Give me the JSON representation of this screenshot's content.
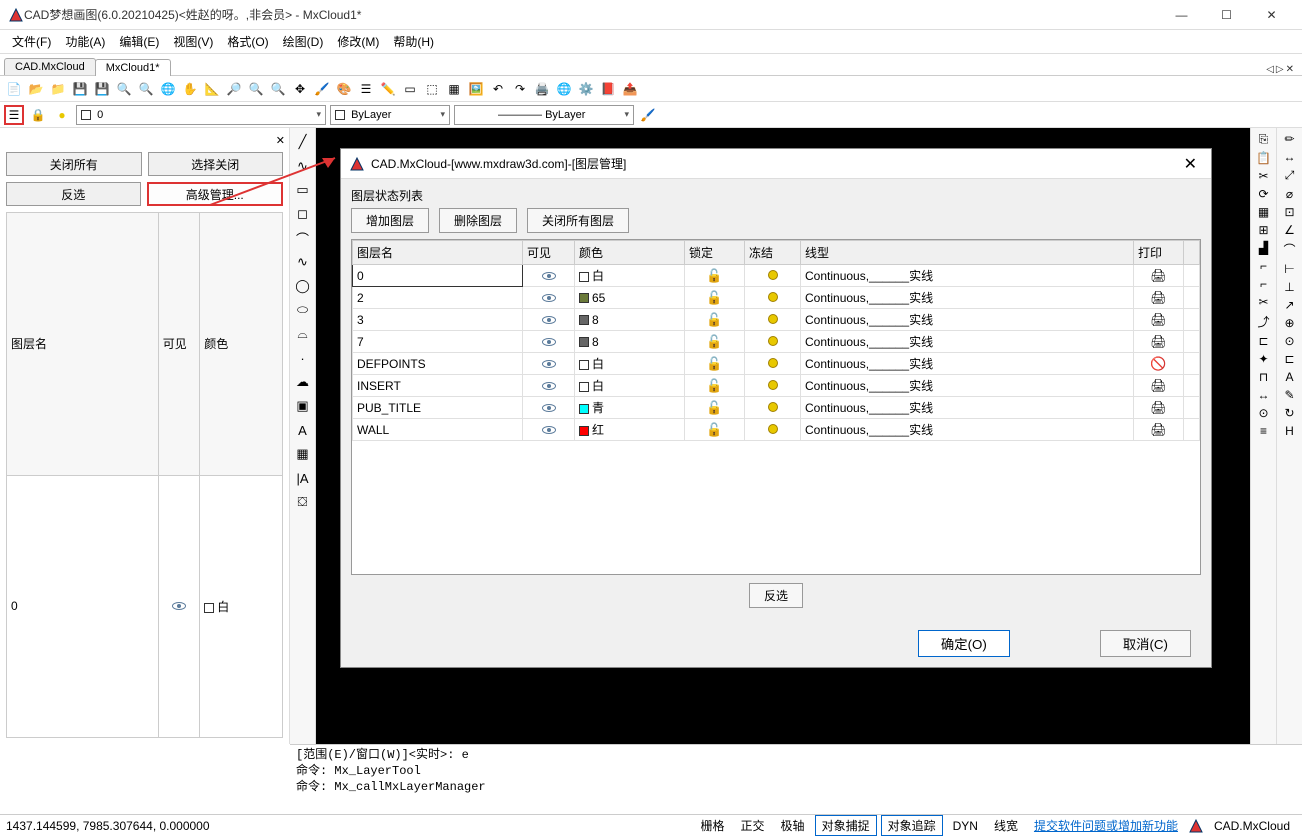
{
  "window": {
    "title": "CAD梦想画图(6.0.20210425)<姓赵的呀。,非会员> - MxCloud1*"
  },
  "menu": [
    "文件(F)",
    "功能(A)",
    "编辑(E)",
    "视图(V)",
    "格式(O)",
    "绘图(D)",
    "修改(M)",
    "帮助(H)"
  ],
  "tabs": {
    "t1": "CAD.MxCloud",
    "t2": "MxCloud1*"
  },
  "layercombo": {
    "value": "0"
  },
  "colorcombo": {
    "value": "ByLayer"
  },
  "ltcombo": {
    "value": "ByLayer"
  },
  "leftpanel": {
    "btn_closeall": "关闭所有",
    "btn_selclose": "选择关闭",
    "btn_invert": "反选",
    "btn_adv": "高级管理...",
    "th_name": "图层名",
    "th_vis": "可见",
    "th_color": "颜色",
    "row_name": "0",
    "row_color": "白"
  },
  "dialog": {
    "title": "CAD.MxCloud-[www.mxdraw3d.com]-[图层管理]",
    "label": "图层状态列表",
    "btn_add": "增加图层",
    "btn_del": "删除图层",
    "btn_closeall": "关闭所有图层",
    "th": {
      "name": "图层名",
      "vis": "可见",
      "color": "颜色",
      "lock": "锁定",
      "freeze": "冻结",
      "lt": "线型",
      "print": "打印"
    },
    "rows": [
      {
        "name": "0",
        "color": "白",
        "sw": "#ffffff",
        "lt": "Continuous,______实线",
        "print": "normal"
      },
      {
        "name": "2",
        "color": "65",
        "sw": "#6b7a3a",
        "lt": "Continuous,______实线",
        "print": "normal"
      },
      {
        "name": "3",
        "color": "8",
        "sw": "#666666",
        "lt": "Continuous,______实线",
        "print": "normal"
      },
      {
        "name": "7",
        "color": "8",
        "sw": "#666666",
        "lt": "Continuous,______实线",
        "print": "normal"
      },
      {
        "name": "DEFPOINTS",
        "color": "白",
        "sw": "#ffffff",
        "lt": "Continuous,______实线",
        "print": "no"
      },
      {
        "name": "INSERT",
        "color": "白",
        "sw": "#ffffff",
        "lt": "Continuous,______实线",
        "print": "normal"
      },
      {
        "name": "PUB_TITLE",
        "color": "青",
        "sw": "#00ffff",
        "lt": "Continuous,______实线",
        "print": "normal"
      },
      {
        "name": "WALL",
        "color": "红",
        "sw": "#ff0000",
        "lt": "Continuous,______实线",
        "print": "normal"
      }
    ],
    "btn_invert": "反选",
    "btn_ok": "确定(O)",
    "btn_cancel": "取消(C)"
  },
  "cmd": {
    "l1": "[范围(E)/窗口(W)]<实时>: e",
    "l2": "命令: Mx_LayerTool",
    "l3": "命令: Mx_callMxLayerManager"
  },
  "status": {
    "coords": "1437.144599,  7985.307644,  0.000000",
    "grid": "栅格",
    "ortho": "正交",
    "polar": "极轴",
    "osnap": "对象捕捉",
    "otrack": "对象追踪",
    "dyn": "DYN",
    "lwt": "线宽",
    "link": "提交软件问题或增加新功能",
    "app": "CAD.MxCloud"
  }
}
